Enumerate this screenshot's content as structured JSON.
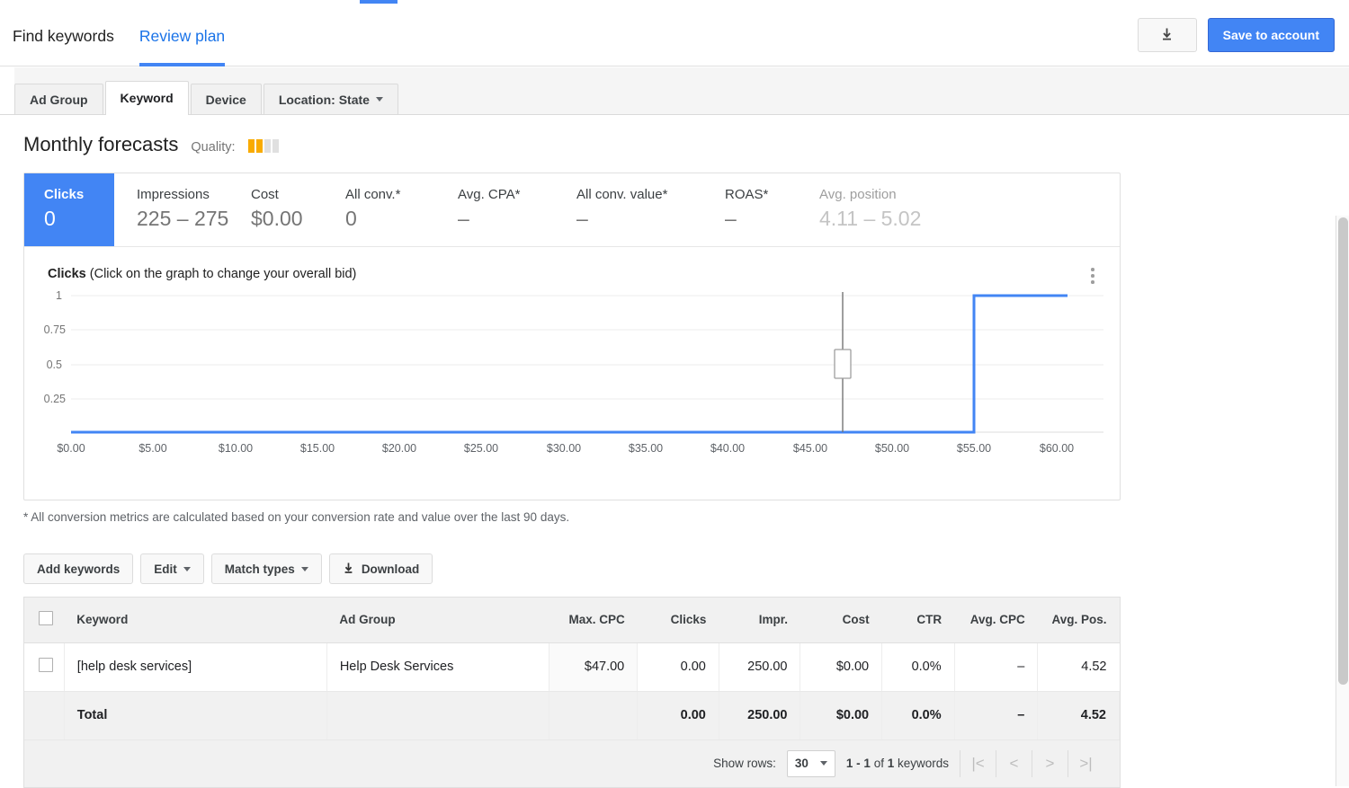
{
  "header": {
    "nav_tabs": [
      {
        "label": "Find keywords",
        "active": false
      },
      {
        "label": "Review plan",
        "active": true
      }
    ],
    "download_icon": "download-icon",
    "save_button": "Save to account",
    "accent_color": "#4285f4"
  },
  "subtabs": [
    {
      "label": "Ad Group",
      "active": false,
      "caret": false
    },
    {
      "label": "Keyword",
      "active": true,
      "caret": false
    },
    {
      "label": "Device",
      "active": false,
      "caret": false
    },
    {
      "label": "Location: State",
      "active": false,
      "caret": true
    }
  ],
  "forecast": {
    "title": "Monthly forecasts",
    "quality_label": "Quality:",
    "quality_filled": 2,
    "quality_total": 4,
    "quality_color": "#f9ab00",
    "metrics": [
      {
        "label": "Clicks",
        "value": "0",
        "state": "selected"
      },
      {
        "label": "Impressions",
        "value": "225 – 275",
        "state": "normal"
      },
      {
        "label": "Cost",
        "value": "$0.00",
        "state": "normal"
      },
      {
        "label": "All conv.*",
        "value": "0",
        "state": "normal"
      },
      {
        "label": "Avg. CPA*",
        "value": "–",
        "state": "normal"
      },
      {
        "label": "All conv. value*",
        "value": "–",
        "state": "normal"
      },
      {
        "label": "ROAS*",
        "value": "–",
        "state": "normal"
      },
      {
        "label": "Avg. position",
        "value": "4.11 – 5.02",
        "state": "muted"
      }
    ],
    "chart_heading_bold": "Clicks",
    "chart_heading_rest": " (Click on the graph to change your overall bid)",
    "menu_icon": "more-vert-icon"
  },
  "chart_data": {
    "type": "line",
    "title": "Clicks (Click on the graph to change your overall bid)",
    "xlabel": "",
    "ylabel": "Clicks",
    "grid": true,
    "legend_position": "none",
    "line_color": "#4285f4",
    "xlim": [
      0,
      62.5
    ],
    "ylim": [
      0,
      1.08
    ],
    "x_tick_labels": [
      "$0.00",
      "$5.00",
      "$10.00",
      "$15.00",
      "$20.00",
      "$25.00",
      "$30.00",
      "$35.00",
      "$40.00",
      "$45.00",
      "$50.00",
      "$55.00",
      "$60.00"
    ],
    "x_ticks": [
      0,
      5,
      10,
      15,
      20,
      25,
      30,
      35,
      40,
      45,
      50,
      55,
      60
    ],
    "y_tick_labels": [
      "0.25",
      "0.5",
      "0.75",
      "1"
    ],
    "y_ticks": [
      0.25,
      0.5,
      0.75,
      1
    ],
    "series": [
      {
        "name": "Clicks",
        "x": [
          0,
          55,
          55,
          62.5
        ],
        "values": [
          0,
          0,
          1,
          1
        ]
      }
    ],
    "bid_marker": {
      "x": 47,
      "label": "current bid handle",
      "handle_y": 0.6
    }
  },
  "footnote": "* All conversion metrics are calculated based on your conversion rate and value over the last 90 days.",
  "toolbar": [
    {
      "label": "Add keywords",
      "caret": false,
      "icon": null
    },
    {
      "label": "Edit",
      "caret": true,
      "icon": null
    },
    {
      "label": "Match types",
      "caret": true,
      "icon": null
    },
    {
      "label": "Download",
      "caret": false,
      "icon": "download-icon"
    }
  ],
  "table": {
    "columns": [
      "Keyword",
      "Ad Group",
      "Max. CPC",
      "Clicks",
      "Impr.",
      "Cost",
      "CTR",
      "Avg. CPC",
      "Avg. Pos."
    ],
    "rows": [
      {
        "keyword": "[help desk services]",
        "ad_group": "Help Desk Services",
        "max_cpc": "$47.00",
        "clicks": "0.00",
        "impr": "250.00",
        "cost": "$0.00",
        "ctr": "0.0%",
        "avg_cpc": "–",
        "avg_pos": "4.52"
      }
    ],
    "total": {
      "label": "Total",
      "clicks": "0.00",
      "impr": "250.00",
      "cost": "$0.00",
      "ctr": "0.0%",
      "avg_cpc": "–",
      "avg_pos": "4.52"
    }
  },
  "pagination": {
    "show_rows_label": "Show rows:",
    "rows_value": "30",
    "range_prefix": "1 - 1",
    "range_middle": " of ",
    "range_count": "1",
    "range_suffix": " keywords",
    "first_icon": "|<",
    "prev_icon": "<",
    "next_icon": ">",
    "last_icon": ">|"
  }
}
